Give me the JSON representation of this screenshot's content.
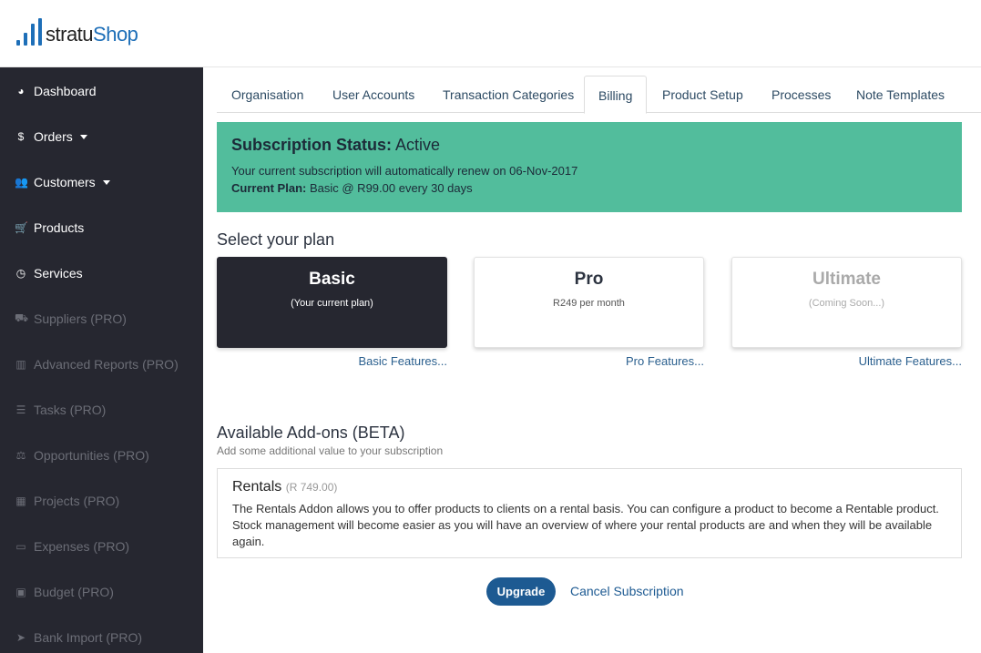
{
  "brand": {
    "name_part1": "stratu",
    "name_part2": "Shop"
  },
  "sidebar": {
    "items": [
      {
        "label": "Dashboard",
        "icon": "tachometer-icon",
        "glyph": "◕",
        "disabled": false,
        "caret": false
      },
      {
        "label": "Orders",
        "icon": "dollar-icon",
        "glyph": "$",
        "disabled": false,
        "caret": true
      },
      {
        "label": "Customers",
        "icon": "users-icon",
        "glyph": "👥",
        "disabled": false,
        "caret": true
      },
      {
        "label": "Products",
        "icon": "cart-icon",
        "glyph": "🛒",
        "disabled": false,
        "caret": false
      },
      {
        "label": "Services",
        "icon": "clock-icon",
        "glyph": "◷",
        "disabled": false,
        "caret": false
      },
      {
        "label": "Suppliers (PRO)",
        "icon": "truck-icon",
        "glyph": "⛟",
        "disabled": true,
        "caret": false
      },
      {
        "label": "Advanced Reports (PRO)",
        "icon": "bar-chart-icon",
        "glyph": "▥",
        "disabled": true,
        "caret": false
      },
      {
        "label": "Tasks (PRO)",
        "icon": "tasks-icon",
        "glyph": "☰",
        "disabled": true,
        "caret": false
      },
      {
        "label": "Opportunities (PRO)",
        "icon": "balance-scale-icon",
        "glyph": "⚖",
        "disabled": true,
        "caret": false
      },
      {
        "label": "Projects (PRO)",
        "icon": "calendar-icon",
        "glyph": "▦",
        "disabled": true,
        "caret": false
      },
      {
        "label": "Expenses (PRO)",
        "icon": "credit-card-icon",
        "glyph": "▭",
        "disabled": true,
        "caret": false
      },
      {
        "label": "Budget (PRO)",
        "icon": "money-icon",
        "glyph": "▣",
        "disabled": true,
        "caret": false
      },
      {
        "label": "Bank Import (PRO)",
        "icon": "paper-plane-icon",
        "glyph": "➤",
        "disabled": true,
        "caret": false
      }
    ]
  },
  "tabs": [
    {
      "label": "Organisation",
      "active": false
    },
    {
      "label": "User Accounts",
      "active": false
    },
    {
      "label": "Transaction Categories",
      "active": false
    },
    {
      "label": "Billing",
      "active": true
    },
    {
      "label": "Product Setup",
      "active": false
    },
    {
      "label": "Processes",
      "active": false
    },
    {
      "label": "Note Templates",
      "active": false
    }
  ],
  "status": {
    "title_label": "Subscription Status:",
    "title_value": "Active",
    "renew_text": "Your current subscription will automatically renew on 06-Nov-2017",
    "plan_label": "Current Plan:",
    "plan_value": "Basic @ R99.00 every 30 days"
  },
  "plans": {
    "title": "Select your plan",
    "items": [
      {
        "name": "Basic",
        "subtitle": "(Your current plan)",
        "features_link": "Basic Features...",
        "state": "current"
      },
      {
        "name": "Pro",
        "subtitle": "R249 per month",
        "features_link": "Pro Features...",
        "state": "available"
      },
      {
        "name": "Ultimate",
        "subtitle": "(Coming Soon...)",
        "features_link": "Ultimate Features...",
        "state": "disabled"
      }
    ]
  },
  "addons": {
    "title": "Available Add-ons (BETA)",
    "subtitle": "Add some additional value to your subscription",
    "items": [
      {
        "name": "Rentals",
        "price": "(R 749.00)",
        "description": "The Rentals Addon allows you to offer products to clients on a rental basis. You can configure a product to become a Rentable product. Stock management will become easier as you will have an overview of where your rental products are and when they will be available again."
      }
    ]
  },
  "actions": {
    "upgrade_label": "Upgrade",
    "cancel_label": "Cancel Subscription"
  },
  "colors": {
    "sidebar_bg": "#262730",
    "status_bg": "#52bd9c",
    "primary": "#1d5a92",
    "brand_blue": "#1e6fb8"
  }
}
